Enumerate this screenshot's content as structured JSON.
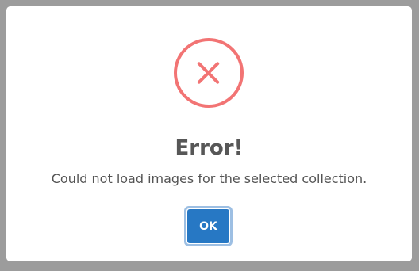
{
  "dialog": {
    "icon": "error-x-icon",
    "title": "Error!",
    "message": "Could not load images for the selected collection.",
    "ok_label": "OK"
  },
  "colors": {
    "backdrop": "#9c9c9c",
    "icon": "#f27474",
    "title_text": "#575757",
    "message_text": "#545454",
    "button_bg": "#2778c4",
    "button_focus_ring": "#9dbfe3"
  }
}
